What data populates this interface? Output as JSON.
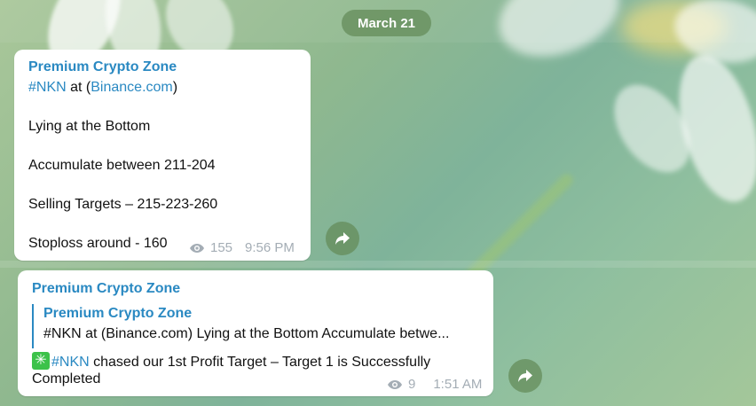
{
  "date_pill": "March 21",
  "messages": [
    {
      "sender": "Premium Crypto Zone",
      "line1": {
        "hashtag": "#NKN",
        "text_before_link": " at (",
        "link": "Binance.com",
        "text_after_link": ")"
      },
      "line2": "Lying at the Bottom",
      "line3": "Accumulate between 211-204",
      "line4": "Selling Targets – 215-223-260",
      "line5": "Stoploss around - 160",
      "views": "155",
      "time": "9:56 PM"
    },
    {
      "sender": "Premium Crypto Zone",
      "quote": {
        "title": "Premium Crypto Zone",
        "text": "#NKN at (Binance.com)  Lying at the Bottom  Accumulate betwe..."
      },
      "body": {
        "hashtag": "#NKN",
        "text": " chased our 1st Profit Target – Target 1 is Successfully",
        "text2": "Completed"
      },
      "views": "9",
      "time": "1:51 AM"
    }
  ],
  "icons": {
    "eye": "eye-icon",
    "share": "share-arrow-icon",
    "check": "sparkle-check-icon"
  }
}
